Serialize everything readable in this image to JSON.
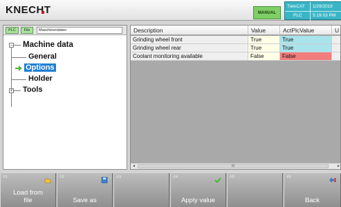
{
  "header": {
    "logo_text": "KNECHT",
    "mode": "MANUAL",
    "status": {
      "system": "TwinCAT",
      "plc": "PLC",
      "date": "1/29/2019",
      "time": "5:19:03 PM"
    },
    "colors": {
      "mode": "#7fcf67",
      "status": "#3ab5c6",
      "logo_accent": "#d0121b"
    }
  },
  "left_panel": {
    "chips": [
      "PLC",
      "File"
    ],
    "breadcrumb": "Maschinendaten",
    "tree": {
      "root": "Machine data",
      "children": [
        "General",
        "Options",
        "Holder",
        "Tools"
      ],
      "selected": "Options"
    }
  },
  "grid": {
    "columns": [
      "Description",
      "Value",
      "ActPlcValue",
      "U"
    ],
    "rows": [
      {
        "description": "Grinding wheel front",
        "value": "True",
        "act": "True",
        "status": "ok"
      },
      {
        "description": "Grinding wheel rear",
        "value": "True",
        "act": "True",
        "status": "ok"
      },
      {
        "description": "Coolant monitoring available",
        "value": "False",
        "act": "False",
        "status": "mismatch"
      }
    ],
    "scroll_thumb": "III"
  },
  "fkeys": [
    {
      "id": "F1",
      "label": "Load  from\nfile",
      "icon": "folder-icon"
    },
    {
      "id": "F2",
      "label": "Save as",
      "icon": "save-icon"
    },
    {
      "id": "F3",
      "label": "",
      "icon": ""
    },
    {
      "id": "F4",
      "label": "Apply value",
      "icon": "check-icon"
    },
    {
      "id": "F5",
      "label": "",
      "icon": ""
    },
    {
      "id": "F6",
      "label": "Back",
      "icon": "back-arrow-icon"
    }
  ]
}
